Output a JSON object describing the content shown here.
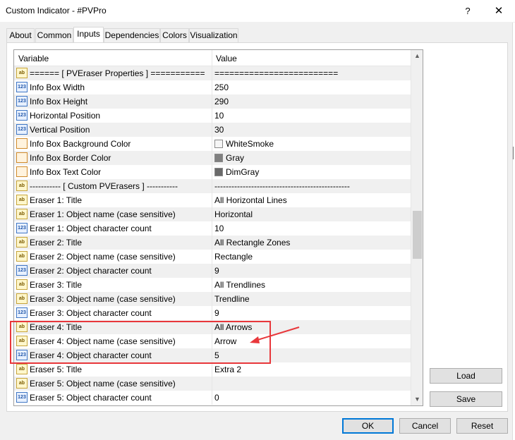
{
  "window": {
    "title": "Custom Indicator - #PVPro",
    "help_label": "?",
    "close_label": "✕"
  },
  "tabs": [
    {
      "label": "About"
    },
    {
      "label": "Common"
    },
    {
      "label": "Inputs"
    },
    {
      "label": "Dependencies"
    },
    {
      "label": "Colors"
    },
    {
      "label": "Visualization"
    }
  ],
  "active_tab": "Inputs",
  "grid": {
    "columns": [
      "Variable",
      "Value"
    ],
    "rows": [
      {
        "icon": "text-icon",
        "type": "ab",
        "name": "====== [ PVEraser Properties ] ===========",
        "value": "========================="
      },
      {
        "icon": "number-icon",
        "type": "123",
        "name": "Info Box Width",
        "value": "250"
      },
      {
        "icon": "number-icon",
        "type": "123",
        "name": "Info Box Height",
        "value": "290"
      },
      {
        "icon": "number-icon",
        "type": "123",
        "name": "Horizontal Position",
        "value": "10"
      },
      {
        "icon": "number-icon",
        "type": "123",
        "name": "Vertical Position",
        "value": "30"
      },
      {
        "icon": "color-icon",
        "type": "color",
        "name": "Info Box Background Color",
        "value": "WhiteSmoke",
        "swatch": "#f5f5f5"
      },
      {
        "icon": "color-icon",
        "type": "color",
        "name": "Info Box Border Color",
        "value": "Gray",
        "swatch": "#808080"
      },
      {
        "icon": "color-icon",
        "type": "color",
        "name": "Info Box Text Color",
        "value": "DimGray",
        "swatch": "#696969"
      },
      {
        "icon": "text-icon",
        "type": "ab",
        "name": "----------- [ Custom PVErasers ] -----------",
        "value": "------------------------------------------------"
      },
      {
        "icon": "text-icon",
        "type": "ab",
        "name": "Eraser 1: Title",
        "value": "All Horizontal Lines"
      },
      {
        "icon": "text-icon",
        "type": "ab",
        "name": "Eraser 1: Object name (case sensitive)",
        "value": "Horizontal"
      },
      {
        "icon": "number-icon",
        "type": "123",
        "name": "Eraser 1: Object character count",
        "value": "10"
      },
      {
        "icon": "text-icon",
        "type": "ab",
        "name": "Eraser 2: Title",
        "value": "All Rectangle Zones"
      },
      {
        "icon": "text-icon",
        "type": "ab",
        "name": "Eraser 2: Object name (case sensitive)",
        "value": "Rectangle"
      },
      {
        "icon": "number-icon",
        "type": "123",
        "name": "Eraser 2: Object character count",
        "value": "9"
      },
      {
        "icon": "text-icon",
        "type": "ab",
        "name": "Eraser 3: Title",
        "value": "All Trendlines"
      },
      {
        "icon": "text-icon",
        "type": "ab",
        "name": "Eraser 3: Object name (case sensitive)",
        "value": "Trendline"
      },
      {
        "icon": "number-icon",
        "type": "123",
        "name": "Eraser 3: Object character count",
        "value": "9"
      },
      {
        "icon": "text-icon",
        "type": "ab",
        "name": "Eraser 4: Title",
        "value": "All Arrows"
      },
      {
        "icon": "text-icon",
        "type": "ab",
        "name": "Eraser 4: Object name (case sensitive)",
        "value": "Arrow"
      },
      {
        "icon": "number-icon",
        "type": "123",
        "name": "Eraser 4: Object character count",
        "value": "5"
      },
      {
        "icon": "text-icon",
        "type": "ab",
        "name": "Eraser 5: Title",
        "value": "Extra 2"
      },
      {
        "icon": "text-icon",
        "type": "ab",
        "name": "Eraser 5: Object name (case sensitive)",
        "value": ""
      },
      {
        "icon": "number-icon",
        "type": "123",
        "name": "Eraser 5: Object character count",
        "value": "0"
      }
    ]
  },
  "side_buttons": {
    "load": "Load",
    "save": "Save"
  },
  "footer_buttons": {
    "ok": "OK",
    "cancel": "Cancel",
    "reset": "Reset"
  },
  "annotation": {
    "color": "#e8373b"
  },
  "icons": {
    "text": "ab",
    "number": "123",
    "scroll_up": "▲",
    "scroll_down": "▼"
  }
}
